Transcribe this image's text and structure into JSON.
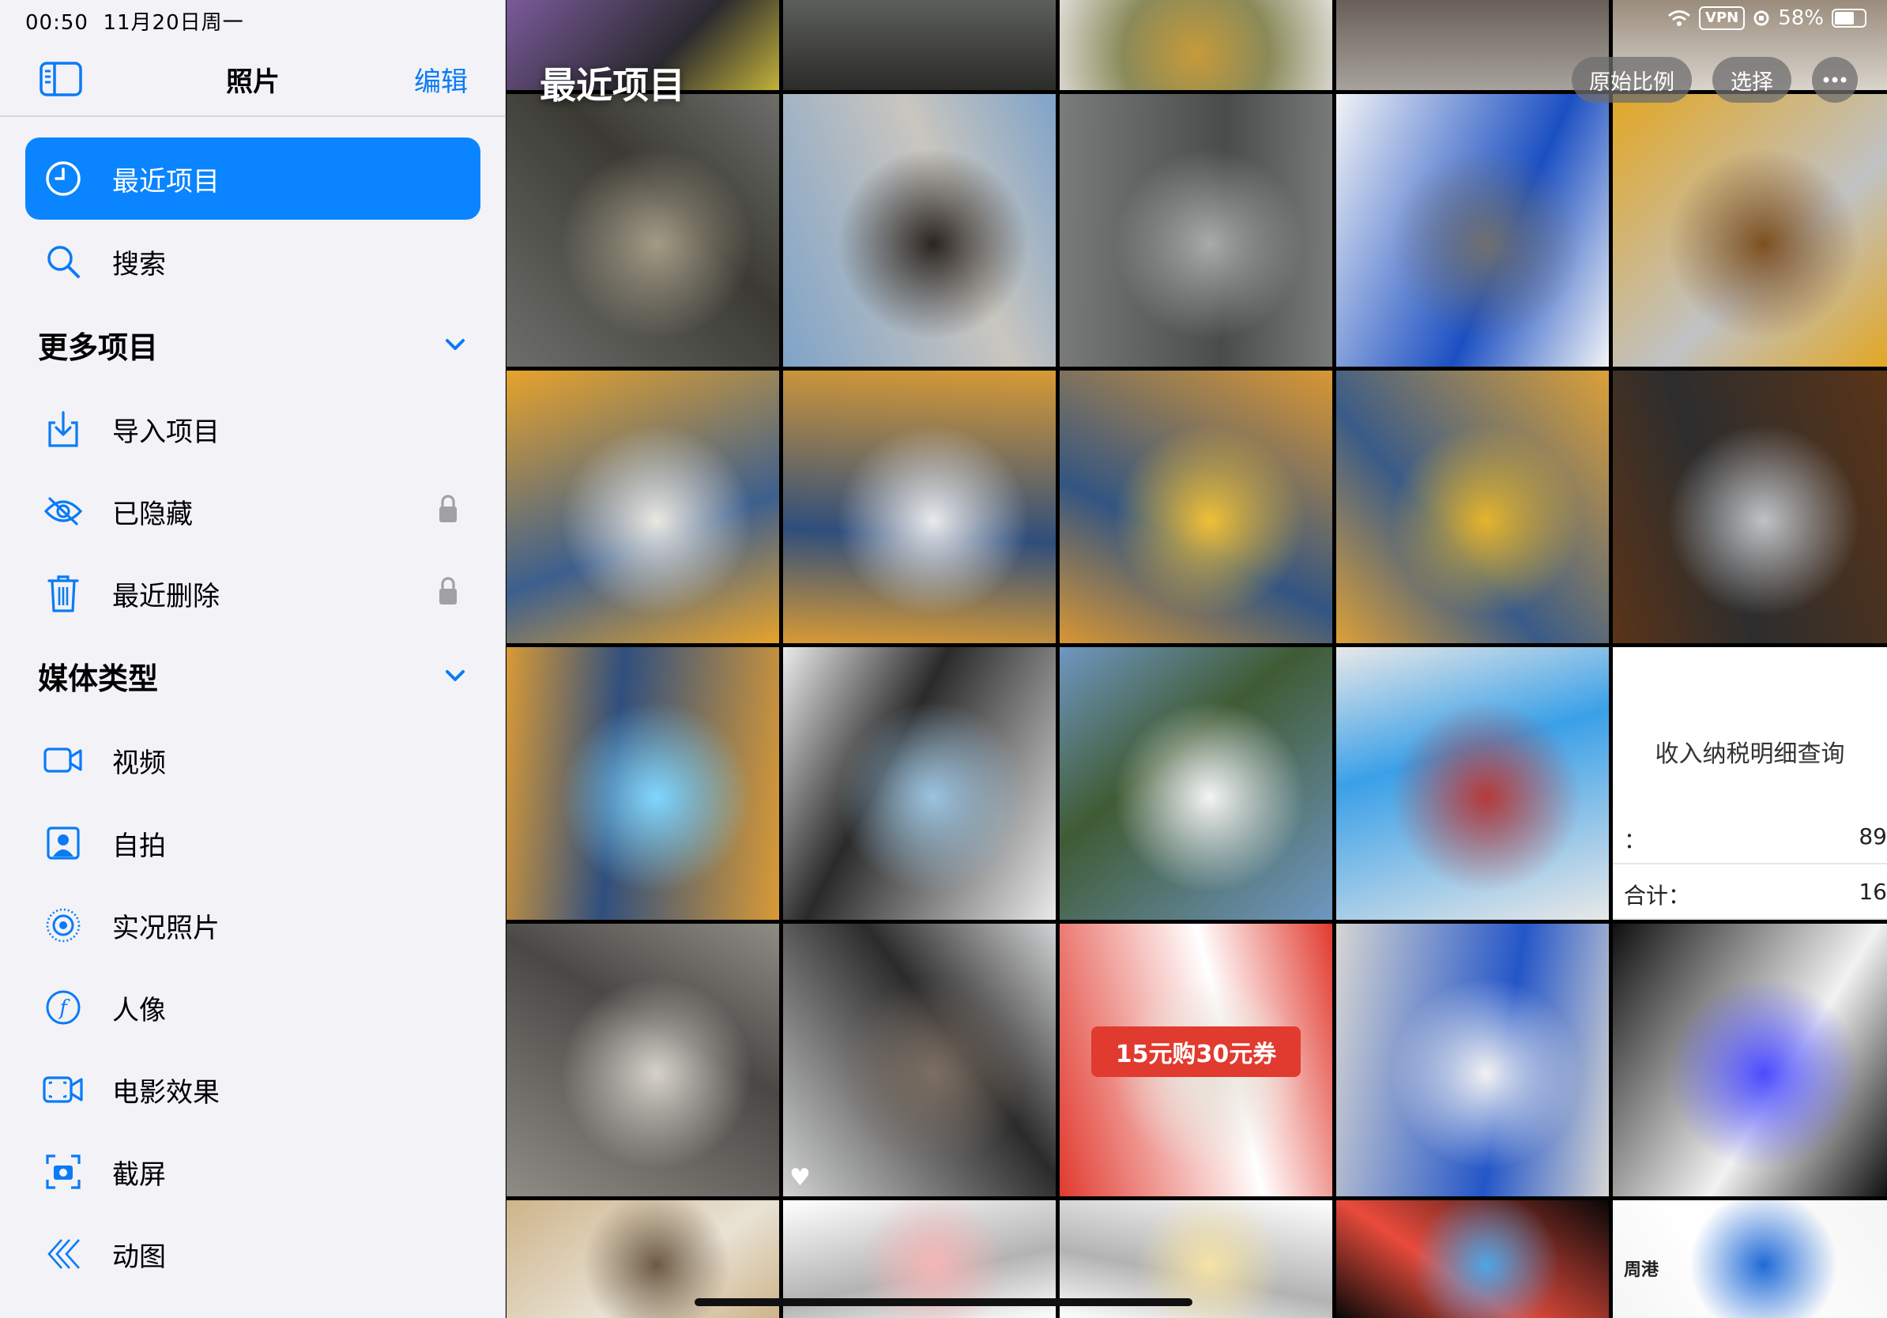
{
  "status_bar": {
    "time": "00:50",
    "date": "11月20日周一",
    "vpn": "VPN",
    "battery": "58%"
  },
  "sidebar": {
    "title": "照片",
    "edit_label": "编辑",
    "items_top": [
      {
        "label": "最近项目",
        "icon": "clock-icon",
        "selected": true
      },
      {
        "label": "搜索",
        "icon": "search-icon",
        "selected": false
      }
    ],
    "sections": [
      {
        "title": "更多项目",
        "items": [
          {
            "label": "导入项目",
            "icon": "import-icon",
            "locked": false
          },
          {
            "label": "已隐藏",
            "icon": "eye-slash-icon",
            "locked": true
          },
          {
            "label": "最近删除",
            "icon": "trash-icon",
            "locked": true
          }
        ]
      },
      {
        "title": "媒体类型",
        "items": [
          {
            "label": "视频",
            "icon": "video-icon"
          },
          {
            "label": "自拍",
            "icon": "selfie-icon"
          },
          {
            "label": "实况照片",
            "icon": "live-photo-icon"
          },
          {
            "label": "人像",
            "icon": "portrait-icon"
          },
          {
            "label": "电影效果",
            "icon": "cinematic-icon"
          },
          {
            "label": "截屏",
            "icon": "screenshot-icon"
          },
          {
            "label": "动图",
            "icon": "animated-icon"
          }
        ]
      }
    ]
  },
  "grid": {
    "title": "最近项目",
    "aspect_button": "原始比例",
    "select_button": "选择",
    "photos": [
      {
        "desc": "street-walkers",
        "palette": [
          "#6d6e6a",
          "#3b3a34",
          "#a39b85"
        ],
        "text": ""
      },
      {
        "desc": "buildings-sign",
        "palette": [
          "#7fa3c8",
          "#c9c6bf",
          "#2b2520"
        ],
        "text": ""
      },
      {
        "desc": "escalator",
        "palette": [
          "#7a7c7b",
          "#4a4c4b",
          "#a9abaa"
        ],
        "text": ""
      },
      {
        "desc": "shopping-bag",
        "palette": [
          "#f1f3f6",
          "#1b4fc2",
          "#6f6f6f"
        ],
        "text": ""
      },
      {
        "desc": "food-bag",
        "palette": [
          "#e3a724",
          "#c0c2c4",
          "#7d5020"
        ],
        "text": ""
      },
      {
        "desc": "pastry-in-box",
        "palette": [
          "#e7a32b",
          "#3d5f8e",
          "#eae8e2"
        ],
        "text": ""
      },
      {
        "desc": "pastry-closeup",
        "palette": [
          "#d89a35",
          "#2f4e7c",
          "#e9eaec"
        ],
        "text": ""
      },
      {
        "desc": "pastry-chopsticks",
        "palette": [
          "#d99633",
          "#335582",
          "#f0c036"
        ],
        "text": ""
      },
      {
        "desc": "pastry-sauce",
        "palette": [
          "#dca038",
          "#3a5b88",
          "#e4b42b"
        ],
        "text": ""
      },
      {
        "desc": "keyboard-food",
        "palette": [
          "#5a3418",
          "#2d2d2d",
          "#bfc3c7"
        ],
        "text": ""
      },
      {
        "desc": "plog-pastry",
        "palette": [
          "#d99a36",
          "#304f7e",
          "#7fd6ff"
        ],
        "text": ""
      },
      {
        "desc": "train-window",
        "palette": [
          "#eaeaea",
          "#2a2a2a",
          "#9bc3df"
        ],
        "text": ""
      },
      {
        "desc": "enoshima-sign",
        "palette": [
          "#6f97c2",
          "#3f5b34",
          "#f4f4f4"
        ],
        "text": ""
      },
      {
        "desc": "metro-ad",
        "palette": [
          "#e8e8e8",
          "#3aa0e8",
          "#b53a3a"
        ],
        "text": ""
      },
      {
        "desc": "tax-screenshot",
        "palette": [
          "#ffffff",
          "#f4f4f4",
          "#333333"
        ],
        "text": "收入纳税明细查询"
      },
      {
        "desc": "alley-street",
        "palette": [
          "#8f8c86",
          "#4a4845",
          "#d6d2cb"
        ],
        "text": ""
      },
      {
        "desc": "traffic-light",
        "palette": [
          "#d1d2d3",
          "#2b2b2b",
          "#7c6e62"
        ],
        "text": ""
      },
      {
        "desc": "coupon-sign",
        "palette": [
          "#e13a2f",
          "#ffffff",
          "#e8e2d8"
        ],
        "text": "15元购30元券"
      },
      {
        "desc": "chapanda-bag",
        "palette": [
          "#d6d5d2",
          "#2456c8",
          "#f2f2f2"
        ],
        "text": ""
      },
      {
        "desc": "piano-keys",
        "palette": [
          "#101010",
          "#f2f2f2",
          "#4a4cff"
        ],
        "text": ""
      },
      {
        "desc": "room-corner",
        "palette": [
          "#cdb48a",
          "#e9e2d4",
          "#6c5a43"
        ],
        "text": ""
      },
      {
        "desc": "document-1",
        "palette": [
          "#ffffff",
          "#b3b3b3",
          "#f5b6b6"
        ],
        "text": ""
      },
      {
        "desc": "document-2",
        "palette": [
          "#ffffff",
          "#b3b3b3",
          "#f5e2a6"
        ],
        "text": ""
      },
      {
        "desc": "planet-sticker",
        "palette": [
          "#080808",
          "#e94b3c",
          "#4fa5e6"
        ],
        "text": ""
      },
      {
        "desc": "profile-screenshot",
        "palette": [
          "#f5f5f5",
          "#ffffff",
          "#1f6ad6"
        ],
        "text": "周港"
      }
    ]
  },
  "colors": {
    "accent": "#0a84ff",
    "sidebar_bg": "#f2f2f7",
    "link": "#0a7bf5"
  }
}
